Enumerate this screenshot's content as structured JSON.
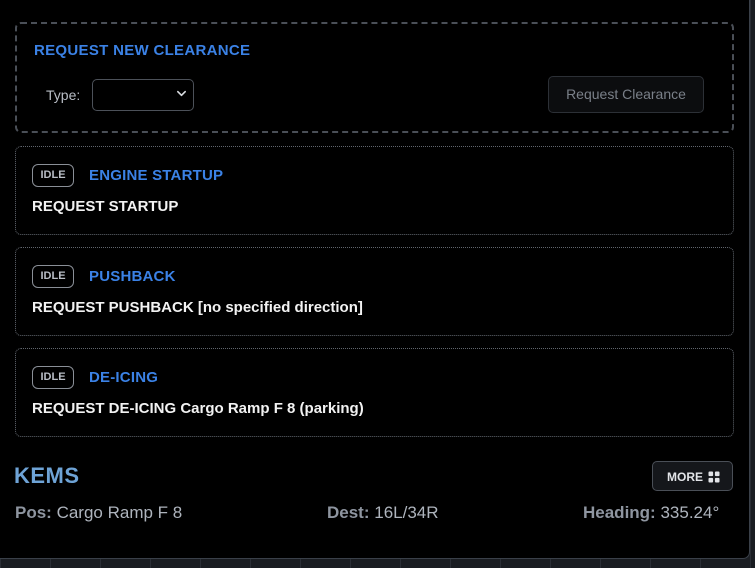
{
  "request": {
    "title": "REQUEST NEW CLEARANCE",
    "type_label": "Type:",
    "type_value": "",
    "button_label": "Request Clearance"
  },
  "cards": [
    {
      "status": "IDLE",
      "title": "ENGINE STARTUP",
      "text": "REQUEST STARTUP"
    },
    {
      "status": "IDLE",
      "title": "PUSHBACK",
      "text": "REQUEST PUSHBACK [no specified direction]"
    },
    {
      "status": "IDLE",
      "title": "DE-ICING",
      "text": "REQUEST DE-ICING Cargo Ramp F 8 (parking)"
    }
  ],
  "footer": {
    "airport": "KEMS",
    "more_label": "MORE",
    "pos_key": "Pos:",
    "pos_value": "Cargo Ramp F 8",
    "dest_key": "Dest:",
    "dest_value": "16L/34R",
    "heading_key": "Heading:",
    "heading_value": "335.24°"
  },
  "colors": {
    "accent": "#3b82e6",
    "airport": "#6ea3d6",
    "background": "#000000"
  },
  "icons": {
    "select": "chevron-down-icon",
    "more": "grid-icon"
  }
}
